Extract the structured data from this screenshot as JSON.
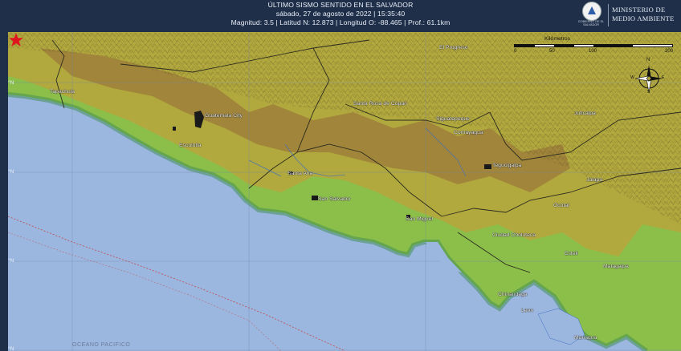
{
  "header": {
    "title": "ÚLTIMO SISMO SENTIDO EN EL SALVADOR",
    "datetime": "sábado, 27 de agosto de 2022 | 15:35:40",
    "details": "Magnitud: 3.5 | Latitud N: 12.873 | Longitud O: -88.465 | Prof.: 61.1km"
  },
  "branding": {
    "gov_text": "GOBIERNO DE EL SALVADOR",
    "ministry_line1": "MINISTERIO DE",
    "ministry_line2": "MEDIO AMBIENTE"
  },
  "scale": {
    "title": "Kilómetros",
    "ticks": [
      "0",
      "50",
      "100",
      "200"
    ]
  },
  "compass": {
    "n": "N",
    "s": "S",
    "e": "E",
    "w": "W"
  },
  "places": [
    {
      "id": "tapachula",
      "name": "Tapachula"
    },
    {
      "id": "guatemala",
      "name": "Guatemala City"
    },
    {
      "id": "escuintla",
      "name": "Escuintla"
    },
    {
      "id": "elprogreso",
      "name": "El Progreso"
    },
    {
      "id": "santarosa",
      "name": "Santa Rosa de Copan"
    },
    {
      "id": "siguatepeque",
      "name": "Siguatepeque"
    },
    {
      "id": "comayagua",
      "name": "Comayagua"
    },
    {
      "id": "juticalpa",
      "name": "Juticalpa"
    },
    {
      "id": "tegucigalpa",
      "name": "Tegucigalpa"
    },
    {
      "id": "santaana",
      "name": "Santa Ana"
    },
    {
      "id": "sansalvador",
      "name": "San Salvador"
    },
    {
      "id": "sanmiguel",
      "name": "San Miguel"
    },
    {
      "id": "cholueca",
      "name": "Ciudad Choluteca"
    },
    {
      "id": "jalapa",
      "name": "Jalapa"
    },
    {
      "id": "ocotal",
      "name": "Ocotal"
    },
    {
      "id": "esteli",
      "name": "Esteli"
    },
    {
      "id": "matagalpa",
      "name": "Matagalpa"
    },
    {
      "id": "chinandega",
      "name": "Chinandega"
    },
    {
      "id": "leon",
      "name": "Leon"
    },
    {
      "id": "managua",
      "name": "Managua"
    }
  ],
  "lat_labels": [
    "°N",
    "°N",
    "°N",
    "°N"
  ],
  "ocean_label": "OCEANO PACIFICO",
  "epicenter": {
    "latitude": 12.873,
    "longitude": -88.465,
    "color": "#e0141e"
  },
  "colors": {
    "ocean": "#9cb7df",
    "coast": "#5fae5a",
    "lowland": "#8cbf4a",
    "hills": "#b9a43c",
    "mountains": "#9a7a3a",
    "header_bg": "#1f2f4a"
  }
}
